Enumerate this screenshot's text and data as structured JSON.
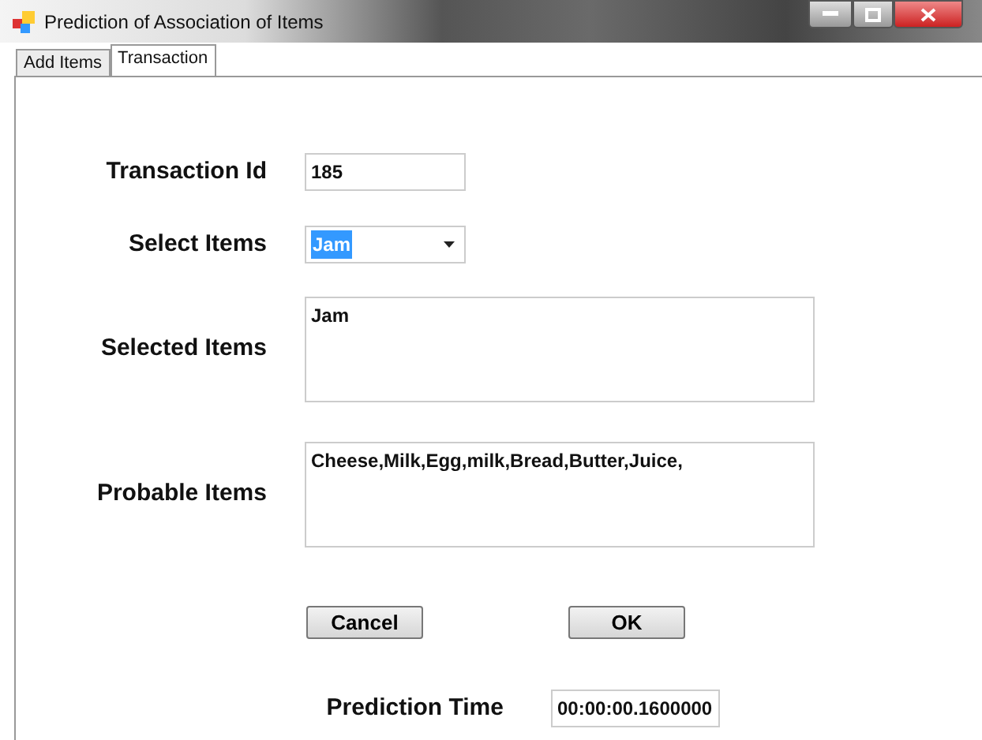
{
  "window": {
    "title": "Prediction of Association of Items"
  },
  "tabs": [
    {
      "label": "Add Items",
      "selected": false
    },
    {
      "label": "Transaction",
      "selected": true
    }
  ],
  "form": {
    "transaction_id": {
      "label": "Transaction Id",
      "value": "185"
    },
    "select_items": {
      "label": "Select Items",
      "value": "Jam"
    },
    "selected_items": {
      "label": "Selected Items",
      "value": "Jam"
    },
    "probable_items": {
      "label": "Probable Items",
      "value": "Cheese,Milk,Egg,milk,Bread,Butter,Juice,"
    }
  },
  "buttons": [
    "Cancel",
    "OK"
  ],
  "prediction_time": {
    "label": "Prediction Time",
    "value": "00:00:00.1600000"
  }
}
